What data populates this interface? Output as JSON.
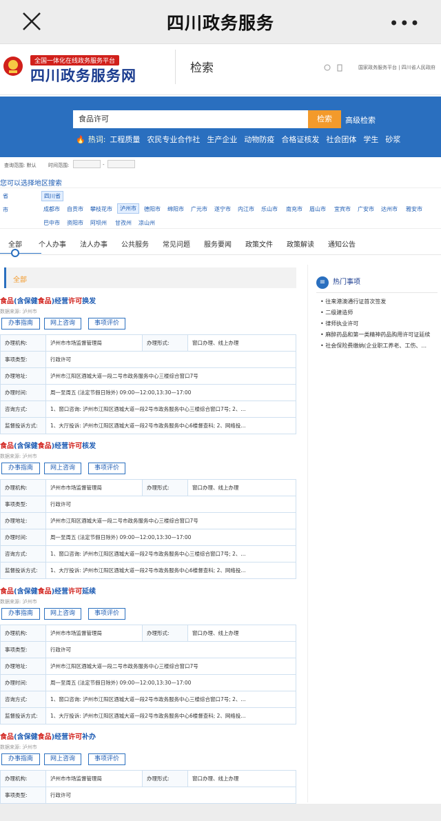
{
  "app": {
    "title": "四川政务服务",
    "more": "•••"
  },
  "site": {
    "banner": "全国一体化在线政务服务平台",
    "name": "四川政务服务网",
    "search_tab": "检索",
    "links": "国家政务服务平台 | 四川省人民政府"
  },
  "search": {
    "query": "食品许可",
    "button": "检索",
    "advanced": "高级检索",
    "hot_label": "热词:",
    "hot_words": [
      "工程质量",
      "农民专业合作社",
      "生产企业",
      "动物防疫",
      "合格证核发",
      "社会团体",
      "学生",
      "砂浆"
    ]
  },
  "filters": {
    "scope_label": "查询范围: 默认",
    "time_label": "时间范围:",
    "dash": "-"
  },
  "region": {
    "title": "您可以选择地区搜索",
    "province_label": "省",
    "city_label": "市",
    "province": "四川省",
    "cities_row1": [
      "成都市",
      "自贡市",
      "攀枝花市",
      "泸州市",
      "德阳市",
      "绵阳市",
      "广元市",
      "遂宁市",
      "内江市",
      "乐山市",
      "南充市",
      "眉山市",
      "宜宾市",
      "广安市",
      "达州市",
      "雅安市"
    ],
    "cities_row2": [
      "巴中市",
      "资阳市",
      "阿坝州",
      "甘孜州",
      "凉山州"
    ],
    "selected": "泸州市"
  },
  "tabs": [
    "全部",
    "个人办事",
    "法人办事",
    "公共服务",
    "常见问题",
    "服务要闻",
    "政策文件",
    "政策解读",
    "通知公告"
  ],
  "section": {
    "label": "全部"
  },
  "hot": {
    "title": "热门事项",
    "items": [
      "• 往来港澳通行证首次签发",
      "• 二级建造师",
      "• 律师执业许可",
      "• 麻醉药品和第一类精神药品购用许可证延续",
      "• 社会保险费缴纳(企业职工养老、工伤、..."
    ]
  },
  "buttons": {
    "guide": "办事指南",
    "consult": "网上咨询",
    "rate": "事项评价"
  },
  "labels": {
    "org": "办理机构:",
    "form": "办理形式:",
    "type": "事项类型:",
    "addr": "办理地址:",
    "time": "办理时间:",
    "ask": "咨询方式:",
    "complain": "监督投诉方式:"
  },
  "results": [
    {
      "t1": "食品",
      "t2": "(含保健",
      "t3": "食品",
      "t4": ")经营",
      "t5": "许可",
      "t6": "换发",
      "src": "数据来源: 泸州市",
      "org": "泸州市市场监督管理局",
      "form": "窗口办理、线上办理",
      "type": "行政许可",
      "addr": "泸州市江阳区酒城大道一段二号市政务服务中心三楼综合窗口7号",
      "time": "周一至周五 (法定节假日除外) 09:00—12:00,13:30—17:00",
      "ask": "1、窗口咨询: 泸州市江阳区酒城大道一段2号市政务服务中心三楼综合窗口7号; 2、...",
      "complain": "1、大厅投诉: 泸州市江阳区酒城大道一段2号市政务服务中心6楼督查科; 2、网络投..."
    },
    {
      "t1": "食品",
      "t2": "(含保健",
      "t3": "食品",
      "t4": ")经营",
      "t5": "许可",
      "t6": "核发",
      "src": "数据来源: 泸州市",
      "org": "泸州市市场监督管理局",
      "form": "窗口办理、线上办理",
      "type": "行政许可",
      "addr": "泸州市江阳区酒城大道一段二号市政务服务中心三楼综合窗口7号",
      "time": "周一至周五 (法定节假日除外) 09:00—12:00,13:30—17:00",
      "ask": "1、窗口咨询: 泸州市江阳区酒城大道一段2号市政务服务中心三楼综合窗口7号; 2、...",
      "complain": "1、大厅投诉: 泸州市江阳区酒城大道一段2号市政务服务中心6楼督查科; 2、网络投..."
    },
    {
      "t1": "食品",
      "t2": "(含保健",
      "t3": "食品",
      "t4": ")经营",
      "t5": "许可",
      "t6": "延续",
      "src": "数据来源: 泸州市",
      "org": "泸州市市场监督管理局",
      "form": "窗口办理、线上办理",
      "type": "行政许可",
      "addr": "泸州市江阳区酒城大道一段二号市政务服务中心三楼综合窗口7号",
      "time": "周一至周五 (法定节假日除外) 09:00—12:00,13:30—17:00",
      "ask": "1、窗口咨询: 泸州市江阳区酒城大道一段2号市政务服务中心三楼综合窗口7号; 2、...",
      "complain": "1、大厅投诉: 泸州市江阳区酒城大道一段2号市政务服务中心6楼督查科; 2、网络投..."
    },
    {
      "t1": "食品",
      "t2": "(含保健",
      "t3": "食品",
      "t4": ")经营",
      "t5": "许可",
      "t6": "补办",
      "src": "数据来源: 泸州市",
      "org": "泸州市市场监督管理局",
      "form": "窗口办理、线上办理",
      "type": "行政许可"
    }
  ]
}
